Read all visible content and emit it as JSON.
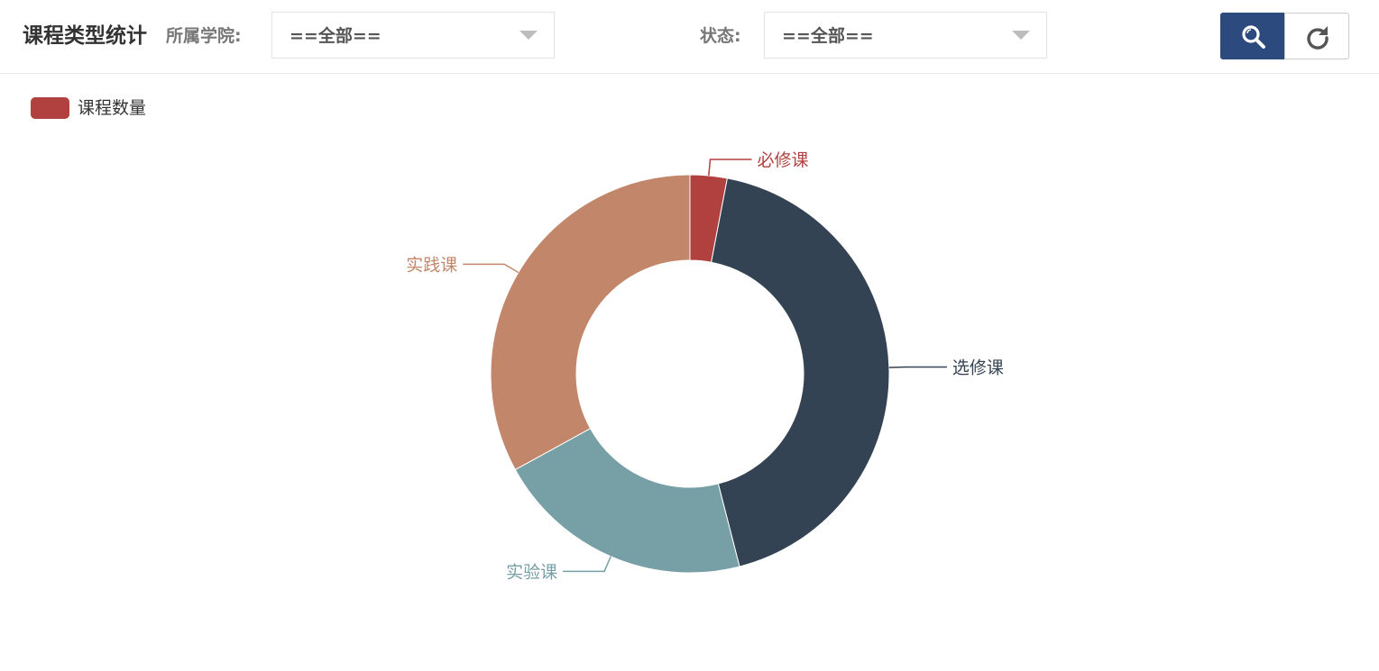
{
  "header": {
    "title": "课程类型统计",
    "college_label": "所属学院:",
    "college_value": "==全部==",
    "status_label": "状态:",
    "status_value": "==全部=="
  },
  "colors": {
    "primary_button": "#2c4a7e"
  },
  "icons": {
    "search": "search-icon",
    "refresh": "refresh-icon"
  },
  "legend": {
    "label": "课程数量",
    "color": "#b0413e"
  },
  "chart_data": {
    "type": "pie",
    "variant": "donut",
    "series_name": "课程数量",
    "slices": [
      {
        "name": "必修课",
        "value": 3,
        "color": "#b0413e"
      },
      {
        "name": "选修课",
        "value": 43,
        "color": "#344353"
      },
      {
        "name": "实验课",
        "value": 21,
        "color": "#779fa6"
      },
      {
        "name": "实践课",
        "value": 33,
        "color": "#c2876b"
      }
    ],
    "legend_position": "top-left"
  }
}
